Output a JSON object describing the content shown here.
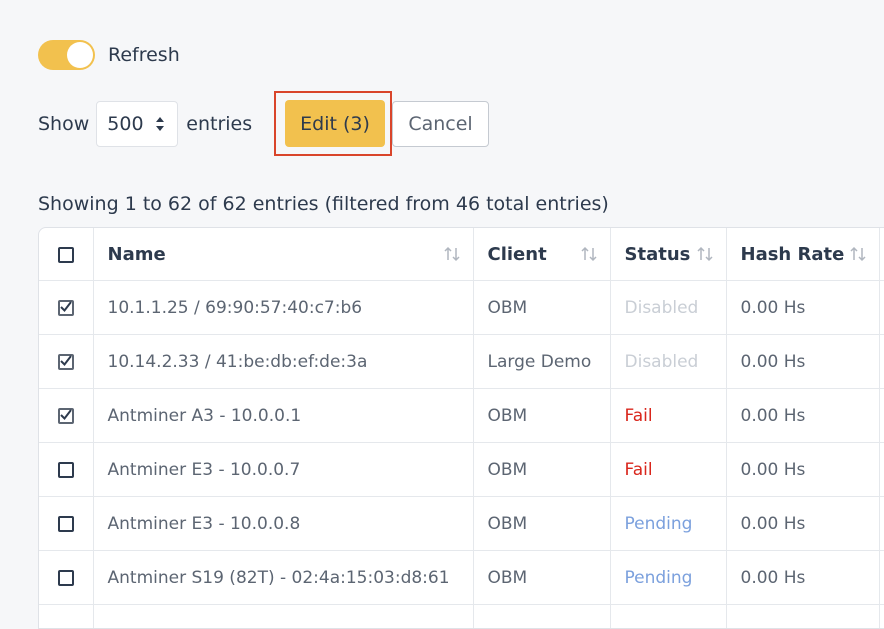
{
  "refresh": {
    "label": "Refresh",
    "enabled": true
  },
  "length": {
    "show_label": "Show",
    "value": "500",
    "entries_label": "entries"
  },
  "actions": {
    "edit_label": "Edit (3)",
    "cancel_label": "Cancel"
  },
  "info": "Showing 1 to 62 of 62 entries (filtered from 46 total entries)",
  "table": {
    "columns": [
      "Name",
      "Client",
      "Status",
      "Hash Rate"
    ],
    "rows": [
      {
        "checked": true,
        "name": "10.1.1.25 / 69:90:57:40:c7:b6",
        "client": "OBM",
        "status": "Disabled",
        "status_type": "disabled",
        "hash_rate": "0.00 Hs"
      },
      {
        "checked": true,
        "name": "10.14.2.33 / 41:be:db:ef:de:3a",
        "client": "Large Demo",
        "status": "Disabled",
        "status_type": "disabled",
        "hash_rate": "0.00 Hs"
      },
      {
        "checked": true,
        "name": "Antminer A3 - 10.0.0.1",
        "client": "OBM",
        "status": "Fail",
        "status_type": "fail",
        "hash_rate": "0.00 Hs"
      },
      {
        "checked": false,
        "name": "Antminer E3 - 10.0.0.7",
        "client": "OBM",
        "status": "Fail",
        "status_type": "fail",
        "hash_rate": "0.00 Hs"
      },
      {
        "checked": false,
        "name": "Antminer E3 - 10.0.0.8",
        "client": "OBM",
        "status": "Pending",
        "status_type": "pending",
        "hash_rate": "0.00 Hs"
      },
      {
        "checked": false,
        "name": "Antminer S19 (82T) - 02:4a:15:03:d8:61",
        "client": "OBM",
        "status": "Pending",
        "status_type": "pending",
        "hash_rate": "0.00 Hs"
      }
    ]
  },
  "colors": {
    "accent": "#f2c14e",
    "highlight": "#d9452b",
    "fail": "#d9261c",
    "pending": "#7ba0dd",
    "disabled": "#c9ced5"
  }
}
